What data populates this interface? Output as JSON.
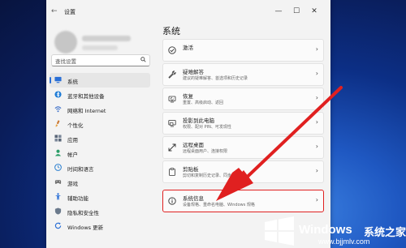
{
  "window": {
    "title": "设置",
    "back_glyph": "←",
    "minimize_glyph": "—",
    "maximize_glyph": "☐",
    "close_glyph": "✕"
  },
  "search": {
    "placeholder": "查找设置"
  },
  "sidebar": {
    "items": [
      {
        "label": "系统",
        "icon": "monitor-icon",
        "color": "#2a6fd6",
        "active": true
      },
      {
        "label": "蓝牙和其他设备",
        "icon": "bluetooth-icon",
        "color": "#1b7ad6",
        "active": false
      },
      {
        "label": "网络和 Internet",
        "icon": "wifi-icon",
        "color": "#3a6ec8",
        "active": false
      },
      {
        "label": "个性化",
        "icon": "brush-icon",
        "color": "#c97a36",
        "active": false
      },
      {
        "label": "应用",
        "icon": "apps-icon",
        "color": "#5a6678",
        "active": false
      },
      {
        "label": "帐户",
        "icon": "account-icon",
        "color": "#2a9d68",
        "active": false
      },
      {
        "label": "时间和语言",
        "icon": "clock-globe-icon",
        "color": "#2a7fd0",
        "active": false
      },
      {
        "label": "游戏",
        "icon": "gamepad-icon",
        "color": "#6c6c6c",
        "active": false
      },
      {
        "label": "辅助功能",
        "icon": "accessibility-icon",
        "color": "#2a6fd6",
        "active": false
      },
      {
        "label": "隐私和安全性",
        "icon": "shield-icon",
        "color": "#6b7a8c",
        "active": false
      },
      {
        "label": "Windows 更新",
        "icon": "update-icon",
        "color": "#2a6fd6",
        "active": false
      }
    ]
  },
  "main": {
    "title": "系统",
    "rows": [
      {
        "title": "激活",
        "subtitle": "",
        "icon": "check-circle-icon"
      },
      {
        "title": "疑难解答",
        "subtitle": "建议的疑难解答、首选项和历史记录",
        "icon": "wrench-icon"
      },
      {
        "title": "恢复",
        "subtitle": "重置、高级启动、返回",
        "icon": "recovery-icon"
      },
      {
        "title": "投影到此电脑",
        "subtitle": "权限、配对 PIN、可发现性",
        "icon": "projector-icon"
      },
      {
        "title": "远程桌面",
        "subtitle": "远程桌面用户、连接权限",
        "icon": "remote-desktop-icon"
      },
      {
        "title": "剪贴板",
        "subtitle": "剪切和复制历史记录、同步、清除",
        "icon": "clipboard-icon"
      },
      {
        "title": "系统信息",
        "subtitle": "设备规格、重命名电脑、Windows 规格",
        "icon": "info-icon"
      }
    ],
    "chevron_glyph": "›"
  },
  "watermark": {
    "brand": "Windows",
    "brand_zh": "系统之家",
    "url": "www.bjjmlv.com"
  },
  "colors": {
    "highlight_border": "#e02020",
    "arrow": "#e02020",
    "accent": "#2a6fd6"
  }
}
